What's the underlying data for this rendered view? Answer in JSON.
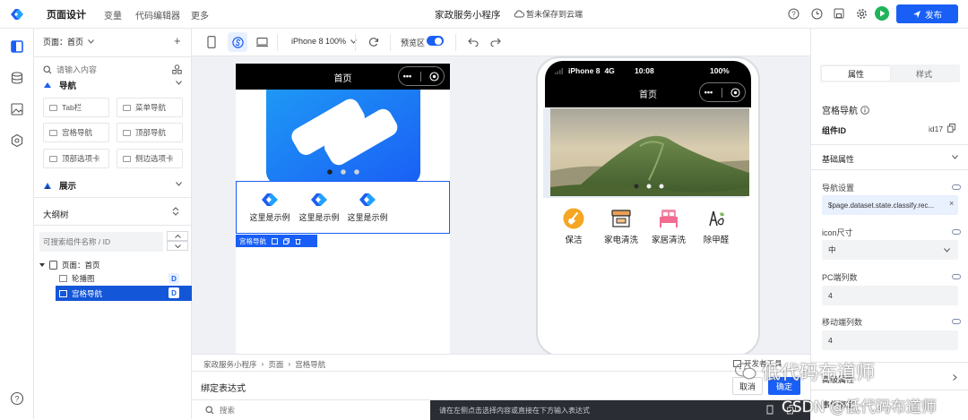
{
  "header": {
    "tab_page_design": "页面设计",
    "tab_variables": "变量",
    "tab_code_editor": "代码编辑器",
    "tab_more": "更多",
    "app_title": "家政服务小程序",
    "cloud_status": "暂未保存到云端",
    "publish_label": "发布"
  },
  "left": {
    "page_select": "页面：首页",
    "search_placeholder": "请输入内容",
    "group_nav": "导航",
    "components": [
      "Tab栏",
      "菜单导航",
      "宫格导航",
      "顶部导航",
      "顶部选项卡",
      "侧边选项卡"
    ],
    "group_display": "展示",
    "outline_title": "大纲树",
    "outline_search_placeholder": "可搜索组件名称 / ID",
    "tree": [
      {
        "label": "页面：首页",
        "badge": ""
      },
      {
        "label": "轮播图",
        "badge": "D"
      },
      {
        "label": "宫格导航",
        "badge": "D"
      }
    ]
  },
  "toolbar": {
    "device": "iPhone 8 100%",
    "preview_label": "预览区",
    "preview_on": true
  },
  "editor_phone": {
    "title": "首页",
    "grid_items": [
      "这里是示例",
      "这里是示例",
      "这里是示例"
    ],
    "selected_label": "宫格导航"
  },
  "preview_phone": {
    "status_device": "iPhone 8",
    "status_net": "4G",
    "status_time": "10:08",
    "status_battery": "100%",
    "title": "首页",
    "nav_items": [
      {
        "label": "保洁",
        "icon": "broom-icon"
      },
      {
        "label": "家电清洗",
        "icon": "appliance-icon"
      },
      {
        "label": "家居清洗",
        "icon": "bed-icon"
      },
      {
        "label": "除甲醛",
        "icon": "formaldehyde-icon"
      }
    ]
  },
  "right": {
    "tab_props": "属性",
    "tab_style": "样式",
    "component_name": "宫格导航",
    "id_label": "组件ID",
    "id_value": "id17",
    "section_basic": "基础属性",
    "nav_setting_label": "导航设置",
    "nav_setting_value": "$page.dataset.state.classify.rec...",
    "icon_size_label": "icon尺寸",
    "icon_size_value": "中",
    "pc_cols_label": "PC端列数",
    "pc_cols_value": "4",
    "mobile_cols_label": "移动端列数",
    "mobile_cols_value": "4",
    "more_label": "高级属性",
    "event_label": "事件绑定"
  },
  "bottom": {
    "breadcrumb": [
      "家政服务小程序",
      "页面",
      "宫格导航"
    ],
    "open_tools": "开发者工具",
    "bind_title": "绑定表达式",
    "cancel": "取消",
    "confirm": "确定",
    "search_placeholder": "搜索",
    "hint": "请在左侧点击选择内容或直接在下方输入表达式"
  },
  "watermark": {
    "text1": "低代码布道师",
    "text2": "CSDN @低代码布道师"
  },
  "colors": {
    "accent": "#1a5ff5",
    "green": "#1fb45a",
    "selected_bg": "#1456d8"
  }
}
